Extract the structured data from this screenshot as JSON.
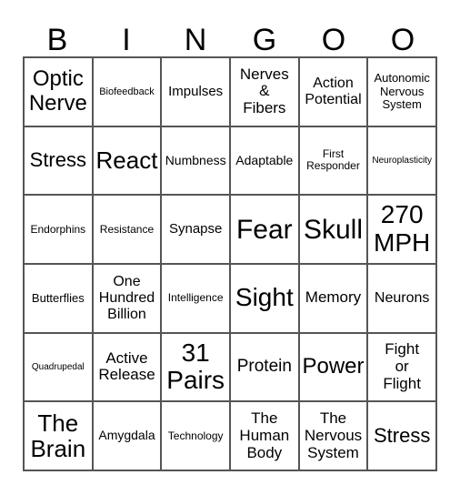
{
  "header": [
    "B",
    "I",
    "N",
    "G",
    "O",
    "O"
  ],
  "cells": [
    [
      "Optic Nerve",
      "Biofeedback",
      "Impulses",
      "Nerves & Fibers",
      "Action Potential",
      "Autonomic Nervous System"
    ],
    [
      "Stress",
      "React",
      "Numbness",
      "Adaptable",
      "First Responder",
      "Neuroplasticity"
    ],
    [
      "Endorphins",
      "Resistance",
      "Synapse",
      "Fear",
      "Skull",
      "270 MPH"
    ],
    [
      "Butterflies",
      "One Hundred Billion",
      "Intelligence",
      "Sight",
      "Memory",
      "Neurons"
    ],
    [
      "Quadrupedal",
      "Active Release",
      "31 Pairs",
      "Protein",
      "Power",
      "Fight or Flight"
    ],
    [
      "The Brain",
      "Amygdala",
      "Technology",
      "The Human Body",
      "The Nervous System",
      "Stress"
    ]
  ]
}
